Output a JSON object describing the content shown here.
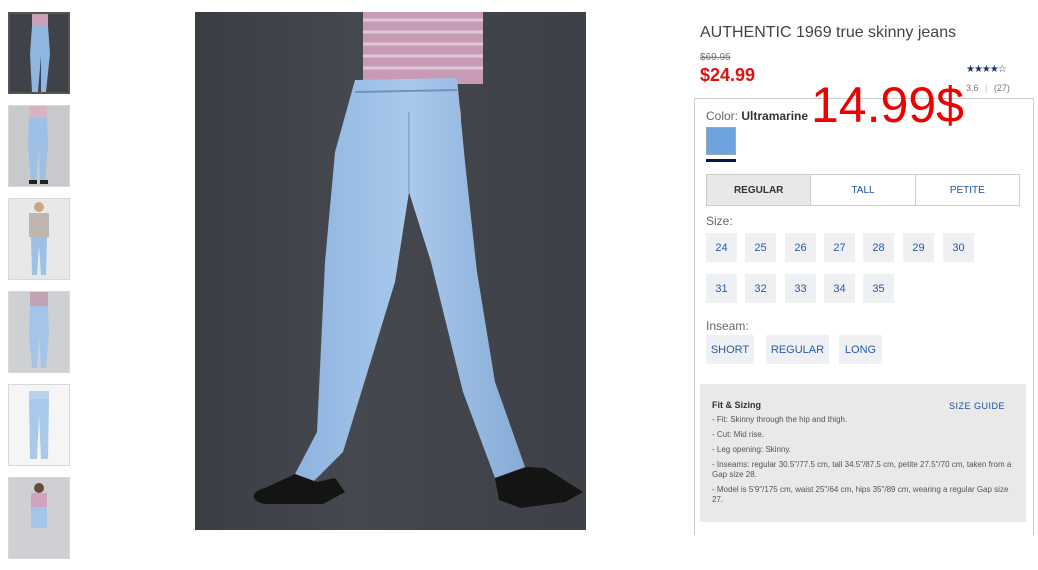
{
  "product": {
    "title": "AUTHENTIC 1969 true skinny jeans",
    "original_price": "$69.95",
    "sale_price": "$24.99",
    "overlay_price": "14.99$",
    "rating_stars": "★★★★☆",
    "rating_value": "3.6",
    "rating_separator": "|",
    "rating_count": "(27)"
  },
  "color": {
    "label": "Color:",
    "value": "Ultramarine"
  },
  "fit_tabs": [
    "REGULAR",
    "TALL",
    "PETITE"
  ],
  "size": {
    "label": "Size:",
    "options": [
      "24",
      "25",
      "26",
      "27",
      "28",
      "29",
      "30",
      "31",
      "32",
      "33",
      "34",
      "35"
    ]
  },
  "inseam": {
    "label": "Inseam:",
    "options": [
      "SHORT",
      "REGULAR",
      "LONG"
    ]
  },
  "fit_sizing": {
    "heading": "Fit & Sizing",
    "guide_link": "SIZE GUIDE",
    "items": [
      "- Fit: Skinny through the hip and thigh.",
      "- Cut: Mid rise.",
      "- Leg opening: Skinny.",
      "- Inseams: regular 30.5\"/77.5 cm, tall 34.5\"/87.5 cm, petite 27.5\"/70 cm, taken from a Gap size 28.",
      "- Model is 5'9\"/175 cm, waist 25\"/64 cm, hips 35\"/89 cm, wearing a regular Gap size 27."
    ]
  },
  "colors": {
    "sale": "#d11111",
    "overlay": "#ee0000",
    "link": "#1b4f9b",
    "swatch": "#6fa3de"
  }
}
